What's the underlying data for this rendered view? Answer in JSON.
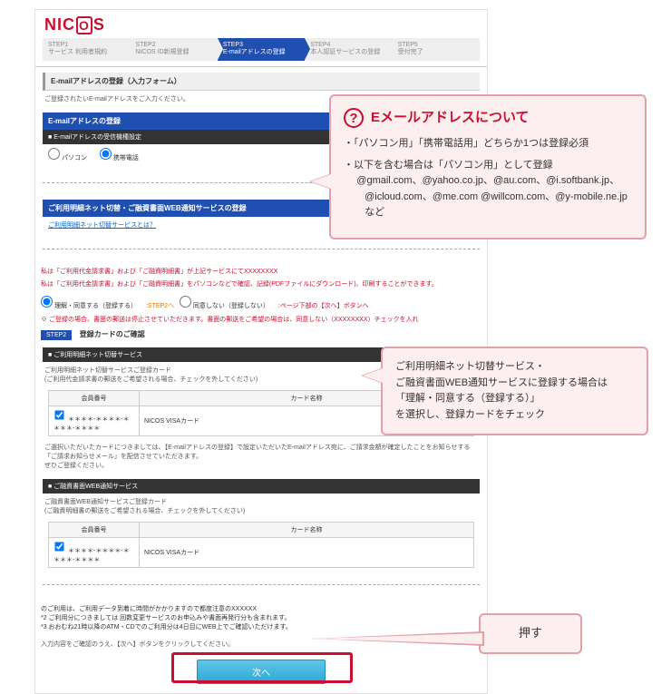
{
  "logo": "NICOS",
  "steps": [
    {
      "num": "STEP1",
      "label": "サービス\n利用者規約"
    },
    {
      "num": "STEP2",
      "label": "NICOS ID新規登録"
    },
    {
      "num": "STEP3",
      "label": "E-mailアドレスの登録"
    },
    {
      "num": "STEP4",
      "label": "本人認証サービスの登録"
    },
    {
      "num": "STEP5",
      "label": "受付完了"
    }
  ],
  "form_title": "E-mailアドレスの登録（入力フォーム）",
  "form_note": "ご登録されたいE-mailアドレスをご入力ください。",
  "blue1": "E-mailアドレスの登録",
  "black1": "E-mailアドレスの受信機種設定",
  "radios": {
    "pc": "パソコン",
    "mobile": "携帯電話"
  },
  "blue2": "ご利用明細ネット切替・ご融資書面WEB通知サービスの登録",
  "link1": "ご利用明細ネット切替サービスとは？",
  "red_note1": "私は「ご利用代金請求書」および「ご融資明細書」が上記サービスにてXXXXXXXX",
  "red_note2": "私は「ご利用代金請求書」および「ご融資明細書」をパソコンなどで確認、記録(PDFファイルにダウンロード)、印刷することができます。",
  "agree": {
    "yes": "理解・同意する（登録する）",
    "yes_link": ":STEP2へ",
    "no": "同意しない（登録しない）",
    "no_link": ":ページ下部の【次へ】ボタンへ"
  },
  "agree_note": "※ ご登録の場合、書面の郵送は停止させていただきます。書面の郵送をご希望の場合は、同意しない（XXXXXXXX）チェックを入れ",
  "step2_tag": "STEP2",
  "step2_title": "登録カードのご確認",
  "black2": "ご利用明細ネット切替サービス",
  "card1_lead": "ご利用明細ネット切替サービスご登録カード\n(ご利用代金請求書の郵送をご希望される場合、チェックを外してください)",
  "th_member": "会員番号",
  "th_card": "カード名称",
  "row1_member": "＊＊＊＊-＊＊＊＊-＊＊＊＊-＊＊＊＊",
  "row1_card": "NICOS VISAカード",
  "card1_note": "ご選択いただいたカードにつきましては、【E-mailアドレスの登録】で設定いただいたE-mailアドレス宛に、ご請求金額が確定したことをお知らせする「ご請求お知らせメール」を配信させていただきます。\nぜひご登録ください。",
  "black3": "ご融資書面WEB通知サービス",
  "card2_lead": "ご融資書面WEB通知サービスご登録カード\n(ご融資明細書の郵送をご希望される場合、チェックを外してください)",
  "row2_member": "＊＊＊＊-＊＊＊＊-＊＊＊＊-＊＊＊＊",
  "row2_card": "NICOS VISAカード",
  "bottom_notes": {
    "n0": "のご利用は、ご利用データ到着に時間がかかりますので都度注意のXXXXXX",
    "n1": "*2 ご利用分につきましては 回数変更サービスのお申込みや書面再発行分も含まれます。",
    "n2": "*3 おおむね21時以降のATM・CDでのご利用分は4日目にWEB上でご確認いただけます。"
  },
  "confirm_text": "入力内容をご確認のうえ、【次へ】ボタンをクリックしてください。",
  "next_label": "次へ",
  "callout1": {
    "title": "Eメールアドレスについて",
    "b1": "「パソコン用」「携帯電話用」どちらか1つは登録必須",
    "b2": "以下を含む場合は「パソコン用」として登録",
    "b2d": "@gmail.com、@yahoo.co.jp、@au.com、@i.softbank.jp、@icloud.com、@me.com @willcom.com、@y-mobile.ne.jp　など"
  },
  "callout2": "ご利用明細ネット切替サービス・\nご融資書面WEB通知サービスに登録する場合は\n「理解・同意する（登録する）」\nを選択し、登録カードをチェック",
  "callout3": "押す"
}
